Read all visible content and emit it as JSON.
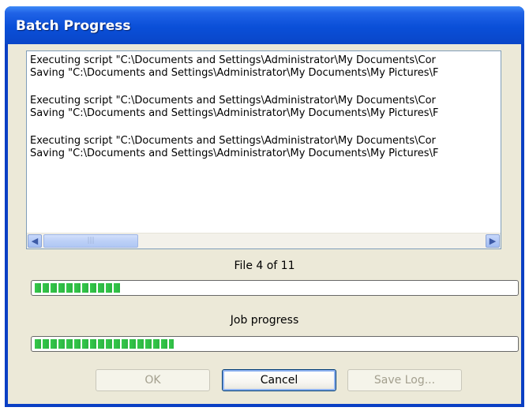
{
  "window": {
    "title": "Batch Progress"
  },
  "log": {
    "lines": [
      "Executing script \"C:\\Documents and Settings\\Administrator\\My Documents\\Cor",
      "Saving \"C:\\Documents and Settings\\Administrator\\My Documents\\My Pictures\\F",
      "",
      "Executing script \"C:\\Documents and Settings\\Administrator\\My Documents\\Cor",
      "Saving \"C:\\Documents and Settings\\Administrator\\My Documents\\My Pictures\\F",
      "",
      "Executing script \"C:\\Documents and Settings\\Administrator\\My Documents\\Cor",
      "Saving \"C:\\Documents and Settings\\Administrator\\My Documents\\My Pictures\\F"
    ],
    "scroll_left_icon": "arrow-left-icon",
    "scroll_right_icon": "arrow-right-icon"
  },
  "file_progress": {
    "label": "File 4 of 11",
    "fraction": 0.18
  },
  "job_progress": {
    "label": "Job progress",
    "fraction": 0.29
  },
  "buttons": {
    "ok": "OK",
    "cancel": "Cancel",
    "save_log": "Save Log..."
  },
  "colors": {
    "titlebar": "#0a4fd8",
    "progress_green": "#34c94a",
    "dialog_bg": "#ece9d8"
  }
}
